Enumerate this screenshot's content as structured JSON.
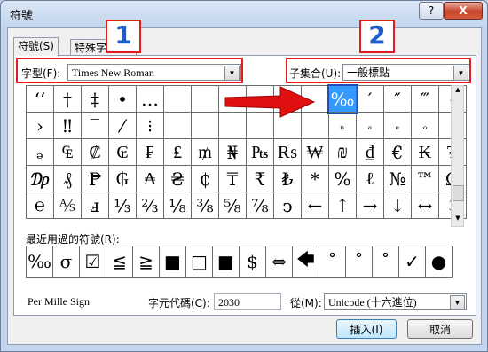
{
  "window": {
    "title": "符號",
    "help": "?",
    "close": "X"
  },
  "tabs": [
    "符號(S)",
    "特殊字元(P)"
  ],
  "font": {
    "label": "字型(F):",
    "value": "Times New Roman"
  },
  "subset": {
    "label": "子集合(U):",
    "value": "一般標點"
  },
  "annotations": [
    "1",
    "2"
  ],
  "grid": [
    [
      "‘‘",
      "†",
      "‡",
      "•",
      "…",
      "",
      "",
      "",
      "",
      "",
      "",
      "‰",
      "′",
      "″",
      "‴",
      "‹"
    ],
    [
      "›",
      "‼",
      "‾",
      "⁄",
      "⁝",
      "",
      "",
      "",
      "",
      "",
      "",
      "ₙ",
      "ₐ",
      "ₑ",
      "ₒ",
      "ₓ"
    ],
    [
      "ₔ",
      "₠",
      "₡",
      "₢",
      "₣",
      "₤",
      "₥",
      "₦",
      "₧",
      "₨",
      "₩",
      "₪",
      "₫",
      "€",
      "₭",
      "₮"
    ],
    [
      "₯",
      "₰",
      "₱",
      "₲",
      "₳",
      "₴",
      "₵",
      "₸",
      "₹",
      "₺",
      "*",
      "%",
      "ℓ",
      "№",
      "™",
      "Ω"
    ],
    [
      "℮",
      "⅍",
      "ⅎ",
      "⅓",
      "⅔",
      "⅛",
      "⅜",
      "⅝",
      "⅞",
      "ↄ",
      "←",
      "↑",
      "→",
      "↓",
      "↔",
      "↕"
    ]
  ],
  "recent": {
    "label": "最近用過的符號(R):",
    "items": [
      "‰",
      "σ",
      "☑",
      "≦",
      "≧",
      "■",
      "□",
      "■",
      "$",
      "⇔",
      "🡄",
      "˚",
      "˚",
      "˚",
      "✓",
      "●"
    ]
  },
  "char_name": "Per Mille Sign",
  "char_code": {
    "label": "字元代碼(C):",
    "value": "2030"
  },
  "from": {
    "label": "從(M):",
    "value": "Unicode (十六進位)"
  },
  "buttons": {
    "insert": "插入(I)",
    "cancel": "取消"
  }
}
